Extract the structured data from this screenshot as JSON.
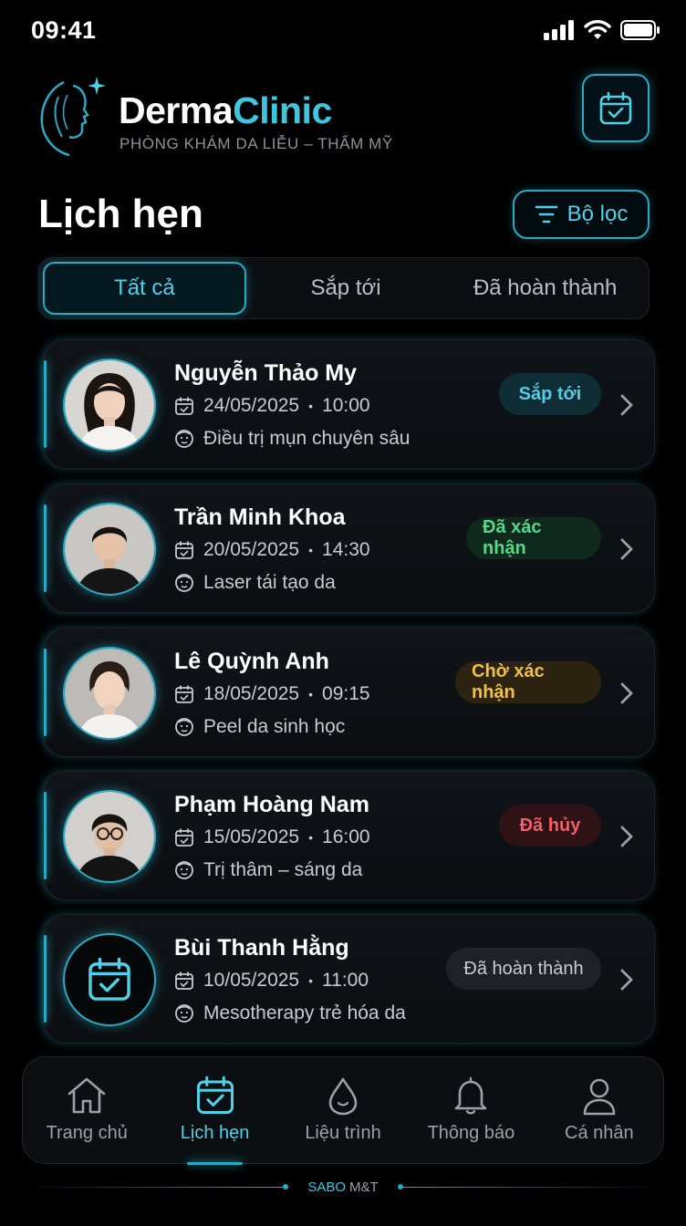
{
  "status_bar": {
    "time": "09:41"
  },
  "brand": {
    "name_part1": "Derma",
    "name_part2": "Clinic",
    "tagline": "PHÒNG KHÁM DA LIỄU – THẨM MỸ"
  },
  "page": {
    "title": "Lịch hẹn",
    "filter_label": "Bộ lọc"
  },
  "tabs": [
    {
      "label": "Tất cả",
      "active": true
    },
    {
      "label": "Sắp tới",
      "active": false
    },
    {
      "label": "Đã hoàn thành",
      "active": false
    }
  ],
  "appointments": [
    {
      "name": "Nguyễn Thảo My",
      "date": "24/05/2025",
      "time": "10:00",
      "service": "Điều trị mụn chuyên sâu",
      "status": "Sắp tới",
      "status_color": "#54cde4",
      "avatar": "photo-woman"
    },
    {
      "name": "Trần Minh Khoa",
      "date": "20/05/2025",
      "time": "14:30",
      "service": "Laser tái tạo da",
      "status": "Đã xác nhận",
      "status_color": "#58d786",
      "avatar": "photo-man"
    },
    {
      "name": "Lê Quỳnh Anh",
      "date": "18/05/2025",
      "time": "09:15",
      "service": "Peel da sinh học",
      "status": "Chờ xác nhận",
      "status_color": "#f0c04a",
      "avatar": "photo-woman"
    },
    {
      "name": "Phạm Hoàng Nam",
      "date": "15/05/2025",
      "time": "16:00",
      "service": "Trị thâm – sáng da",
      "status": "Đã hủy",
      "status_color": "#ef5f69",
      "avatar": "photo-man-glasses"
    },
    {
      "name": "Bùi Thanh Hằng",
      "date": "10/05/2025",
      "time": "11:00",
      "service": "Mesotherapy trẻ hóa da",
      "status": "Đã hoàn thành",
      "status_color": "#c8cdd1",
      "avatar": "calendar-check-icon"
    }
  ],
  "bottom_nav": [
    {
      "label": "Trang chủ",
      "icon": "home-icon",
      "active": false
    },
    {
      "label": "Lịch hẹn",
      "icon": "calendar-check-icon",
      "active": true
    },
    {
      "label": "Liệu trình",
      "icon": "drop-icon",
      "active": false
    },
    {
      "label": "Thông báo",
      "icon": "bell-icon",
      "active": false
    },
    {
      "label": "Cá nhân",
      "icon": "user-icon",
      "active": false
    }
  ],
  "footer": {
    "brand": "SABO",
    "suffix": "M&T"
  },
  "colors": {
    "accent": "#2aa9c2",
    "accent_light": "#4fd2e8",
    "background": "#000000"
  }
}
